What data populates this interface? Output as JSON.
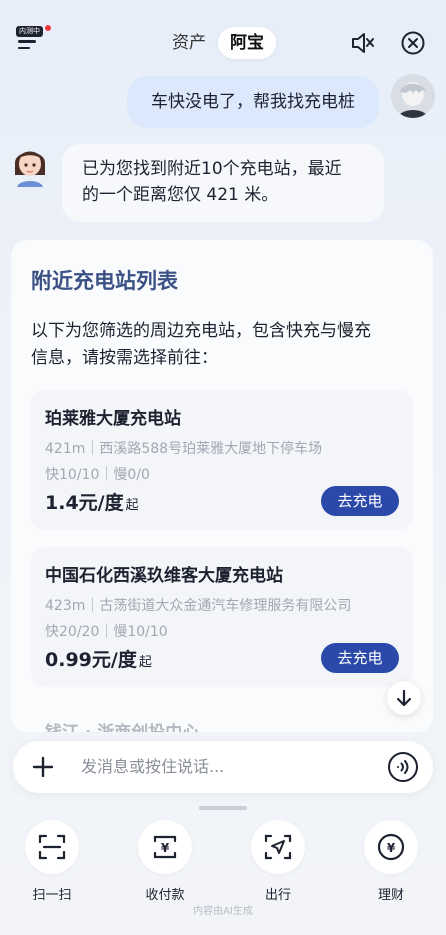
{
  "header": {
    "badge": "内测中",
    "tabs": [
      {
        "label": "资产"
      },
      {
        "label": "阿宝"
      }
    ],
    "active_tab": "阿宝"
  },
  "chat": {
    "user_message": "车快没电了，帮我找充电桩",
    "bot_message_line1": "已为您找到附近10个充电站，最近",
    "bot_message_line2": "的一个距离您仅 421 米。"
  },
  "card": {
    "title": "附近充电站列表",
    "intro_line1": "以下为您筛选的周边充电站，包含快充与慢充",
    "intro_line2": "信息，请按需选择前往："
  },
  "stations": [
    {
      "name": "珀莱雅大厦充电站",
      "address": "421m｜西溪路588号珀莱雅大厦地下停车场",
      "slots": "快10/10｜慢0/0",
      "price": "1.4元/度",
      "price_suffix": "起",
      "button": "去充电"
    },
    {
      "name": "中国石化西溪玖维客大厦充电站",
      "address": "423m｜古荡街道大众金通汽车修理服务有限公司",
      "slots": "快20/20｜慢10/10",
      "price": "0.99元/度",
      "price_suffix": "起",
      "button": "去充电"
    },
    {
      "name": "钱江 · 浙商创投中心"
    }
  ],
  "input": {
    "placeholder": "发消息或按住说话..."
  },
  "nav": [
    {
      "label": "扫一扫",
      "icon": "scan-icon"
    },
    {
      "label": "收付款",
      "icon": "payment-icon"
    },
    {
      "label": "出行",
      "icon": "navigation-icon"
    },
    {
      "label": "理财",
      "icon": "finance-icon"
    }
  ],
  "footer": "内容由AI生成",
  "colors": {
    "accent": "#2b49a8",
    "title": "#3b5186",
    "user_bubble": "#dce8fb"
  }
}
